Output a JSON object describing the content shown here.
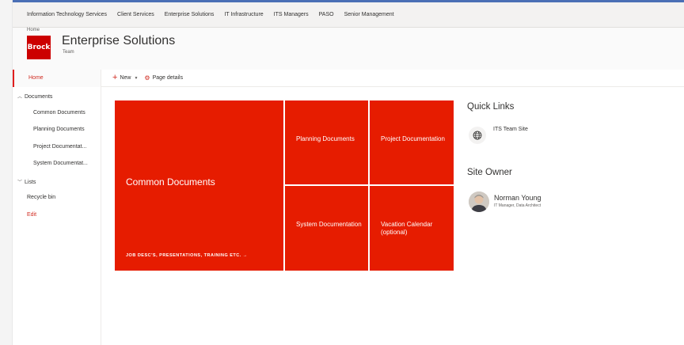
{
  "topnav": {
    "items": [
      "Information Technology Services",
      "Client Services",
      "Enterprise Solutions",
      "IT Infrastructure",
      "ITS Managers",
      "PASO",
      "Senior Management"
    ]
  },
  "header": {
    "breadcrumb": "Home",
    "logo_text": "Brock",
    "title": "Enterprise Solutions",
    "subtitle": "Team"
  },
  "sidebar": {
    "home": "Home",
    "documents": "Documents",
    "doc_items": [
      "Common Documents",
      "Planning Documents",
      "Project Documentat...",
      "System Documentat..."
    ],
    "lists": "Lists",
    "recycle_bin": "Recycle bin",
    "edit": "Edit"
  },
  "commandbar": {
    "new_label": "New",
    "page_details_label": "Page details"
  },
  "tiles": {
    "big": {
      "title": "Common Documents",
      "subtitle": "JOB DESC'S, PRESENTATIONS, TRAINING ETC. →"
    },
    "t1": "Planning Documents",
    "t2": "Project Documentation",
    "t3": "System Documentation",
    "t4": "Vacation Calendar (optional)"
  },
  "quick_links": {
    "title": "Quick Links",
    "item": "ITS Team Site"
  },
  "site_owner": {
    "title": "Site Owner",
    "name": "Norman Young",
    "role": "IT Manager, Data Architect"
  },
  "colors": {
    "accent": "#d02b21",
    "tile": "#e61c00",
    "top_accent": "#4a6fb5"
  }
}
